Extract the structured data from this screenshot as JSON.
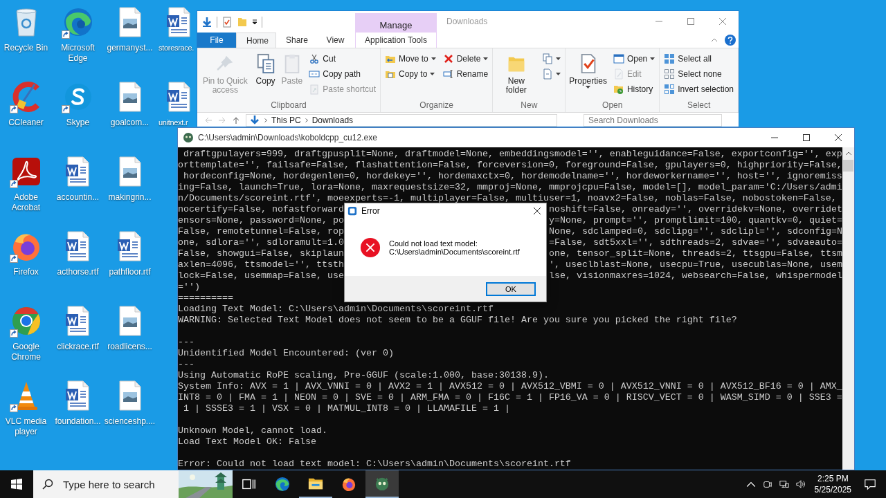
{
  "desktop": {
    "icons": [
      {
        "label": "Recycle Bin",
        "kind": "recycle-bin",
        "shortcut": false
      },
      {
        "label": "CCleaner",
        "kind": "ccleaner",
        "shortcut": true
      },
      {
        "label": "Adobe Acrobat",
        "kind": "acrobat",
        "shortcut": true
      },
      {
        "label": "Firefox",
        "kind": "firefox",
        "shortcut": true
      },
      {
        "label": "Google Chrome",
        "kind": "chrome",
        "shortcut": true
      },
      {
        "label": "VLC media player",
        "kind": "vlc",
        "shortcut": true
      },
      {
        "label": "Microsoft Edge",
        "kind": "edge",
        "shortcut": true
      },
      {
        "label": "Skype",
        "kind": "skype",
        "shortcut": true
      },
      {
        "label": "accountin...",
        "kind": "doc-file",
        "shortcut": false
      },
      {
        "label": "acthorse.rtf",
        "kind": "doc-file",
        "shortcut": false
      },
      {
        "label": "clickrace.rtf",
        "kind": "doc-file",
        "shortcut": false
      },
      {
        "label": "foundation...",
        "kind": "doc-file",
        "shortcut": false
      },
      {
        "label": "germanyst...",
        "kind": "image-file",
        "shortcut": false
      },
      {
        "label": "goalcom...",
        "kind": "image-file",
        "shortcut": false
      },
      {
        "label": "makingrin...",
        "kind": "image-file",
        "shortcut": false
      },
      {
        "label": "pathfloor.rtf",
        "kind": "doc-file",
        "shortcut": false
      },
      {
        "label": "roadlicens...",
        "kind": "image-file",
        "shortcut": false
      },
      {
        "label": "scienceshp....",
        "kind": "image-file",
        "shortcut": false
      },
      {
        "label": "storesrace.",
        "kind": "doc-file",
        "shortcut": false
      },
      {
        "label": "unitnext.r",
        "kind": "doc-file",
        "shortcut": false
      }
    ]
  },
  "explorer": {
    "context_tab": "Manage",
    "title": "Downloads",
    "tabs": [
      {
        "label": "File",
        "kind": "file",
        "selected": false
      },
      {
        "label": "Home",
        "kind": "normal",
        "selected": true
      },
      {
        "label": "Share",
        "kind": "normal",
        "selected": false
      },
      {
        "label": "View",
        "kind": "normal",
        "selected": false
      },
      {
        "label": "Application Tools",
        "kind": "context",
        "selected": false
      }
    ],
    "ribbon": [
      {
        "label": "Clipboard",
        "columns": [
          {
            "kind": "large",
            "items": [
              {
                "label": "Pin to Quick access",
                "disabled": true,
                "dropdown": false
              }
            ]
          },
          {
            "kind": "large",
            "items": [
              {
                "label": "Copy",
                "disabled": false,
                "dropdown": false
              }
            ]
          },
          {
            "kind": "large",
            "items": [
              {
                "label": "Paste",
                "disabled": true,
                "dropdown": false
              }
            ]
          },
          {
            "kind": "stack",
            "items": [
              {
                "label": "Cut",
                "disabled": false,
                "dropdown": false
              },
              {
                "label": "Copy path",
                "disabled": false,
                "dropdown": false
              },
              {
                "label": "Paste shortcut",
                "disabled": true,
                "dropdown": false
              }
            ]
          }
        ]
      },
      {
        "label": "Organize",
        "columns": [
          {
            "kind": "stack",
            "items": [
              {
                "label": "Move to",
                "disabled": false,
                "dropdown": true
              },
              {
                "label": "Copy to",
                "disabled": false,
                "dropdown": true
              }
            ]
          },
          {
            "kind": "stack",
            "items": [
              {
                "label": "Delete",
                "disabled": false,
                "dropdown": true
              },
              {
                "label": "Rename",
                "disabled": false,
                "dropdown": false
              }
            ]
          }
        ]
      },
      {
        "label": "New",
        "columns": [
          {
            "kind": "large",
            "items": [
              {
                "label": "New folder",
                "disabled": false,
                "dropdown": false
              }
            ]
          },
          {
            "kind": "stack",
            "items": [
              {
                "disabled": false,
                "dropdown": true
              },
              {
                "disabled": false,
                "dropdown": true
              }
            ]
          }
        ]
      },
      {
        "label": "Open",
        "columns": [
          {
            "kind": "large",
            "items": [
              {
                "label": "Properties",
                "disabled": false,
                "dropdown": true
              }
            ]
          },
          {
            "kind": "stack",
            "items": [
              {
                "label": "Open",
                "disabled": false,
                "dropdown": true
              },
              {
                "label": "Edit",
                "disabled": true,
                "dropdown": false
              },
              {
                "label": "History",
                "disabled": false,
                "dropdown": false
              }
            ]
          }
        ]
      },
      {
        "label": "Select",
        "columns": [
          {
            "kind": "stack",
            "items": [
              {
                "label": "Select all",
                "disabled": false,
                "dropdown": false
              },
              {
                "label": "Select none",
                "disabled": false,
                "dropdown": false
              },
              {
                "label": "Invert selection",
                "disabled": false,
                "dropdown": false
              }
            ]
          }
        ]
      }
    ],
    "breadcrumbs": [
      "This PC",
      "Downloads"
    ],
    "search_placeholder": "Search Downloads"
  },
  "console": {
    "title": "C:\\Users\\admin\\Downloads\\koboldcpp_cu12.exe",
    "lines": [
      {
        "kind": "text",
        "text": " draftgpulayers=999, draftgpusplit=None, draftmodel=None, embeddingsmodel='', enableguidance=False, exportconfig='', exp"
      },
      {
        "kind": "text",
        "text": "orttemplate='', failsafe=False, flashattention=False, forceversion=0, foreground=False, gpulayers=0, highpriority=False,"
      },
      {
        "kind": "text",
        "text": " hordeconfig=None, hordegenlen=0, hordekey='', hordemaxctx=0, hordemodelname='', hordeworkername='', host='', ignoremiss"
      },
      {
        "kind": "text",
        "text": "ing=False, launch=True, lora=None, maxrequestsize=32, mmproj=None, mmprojcpu=False, model=[], model_param='C:/Users/admi"
      },
      {
        "kind": "text",
        "text": "n/Documents/scoreint.rtf', moeexperts=-1, multiplayer=False, multiuser=1, noavx2=False, noblas=False, nobostoken=False,"
      },
      {
        "kind": "split",
        "left": "nocertify=False, nofastforward",
        "right": "noshift=False, onready='', overridekv=None, overridet"
      },
      {
        "kind": "split",
        "left": "ensors=None, password=None, po",
        "right": "y=None, prompt='', promptlimit=100, quantkv=0, quiet="
      },
      {
        "kind": "split",
        "left": "False, remotetunnel=False, rop",
        "right": "None, sdclamped=0, sdclipg='', sdclipl='', sdconfig=N"
      },
      {
        "kind": "split",
        "left": "one, sdlora='', sdloramult=1.0",
        "right": "=False, sdt5xxl='', sdthreads=2, sdvae='', sdvaeauto="
      },
      {
        "kind": "split",
        "left": "False, showgui=False, skiplaun",
        "right": "one, tensor_split=None, threads=2, ttsgpu=False, ttsm"
      },
      {
        "kind": "split",
        "left": "axlen=4096, ttsmodel='', ttsth",
        "right": "', useclblast=None, usecpu=True, usecublas=None, usem"
      },
      {
        "kind": "split",
        "left": "lock=False, usemmap=False, use",
        "right": "lse, visionmaxres=1024, websearch=False, whispermodel"
      },
      {
        "kind": "text",
        "text": "='')"
      },
      {
        "kind": "text",
        "text": "=========="
      },
      {
        "kind": "text",
        "text": "Loading Text Model: C:\\Users\\admin\\Documents\\scoreint.rtf"
      },
      {
        "kind": "text",
        "text": "WARNING: Selected Text Model does not seem to be a GGUF file! Are you sure you picked the right file?"
      },
      {
        "kind": "blank"
      },
      {
        "kind": "text",
        "text": "---"
      },
      {
        "kind": "text",
        "text": "Unidentified Model Encountered: (ver 0)"
      },
      {
        "kind": "text",
        "text": "---"
      },
      {
        "kind": "text",
        "text": "Using Automatic RoPE scaling, Pre-GGUF (scale:1.000, base:30138.9)."
      },
      {
        "kind": "text",
        "text": "System Info: AVX = 1 | AVX_VNNI = 0 | AVX2 = 1 | AVX512 = 0 | AVX512_VBMI = 0 | AVX512_VNNI = 0 | AVX512_BF16 = 0 | AMX_"
      },
      {
        "kind": "text",
        "text": "INT8 = 0 | FMA = 1 | NEON = 0 | SVE = 0 | ARM_FMA = 0 | F16C = 1 | FP16_VA = 0 | RISCV_VECT = 0 | WASM_SIMD = 0 | SSE3 ="
      },
      {
        "kind": "text",
        "text": " 1 | SSSE3 = 1 | VSX = 0 | MATMUL_INT8 = 0 | LLAMAFILE = 1 |"
      },
      {
        "kind": "blank"
      },
      {
        "kind": "text",
        "text": "Unknown Model, cannot load."
      },
      {
        "kind": "text",
        "text": "Load Text Model OK: False"
      },
      {
        "kind": "blank"
      },
      {
        "kind": "text",
        "text": "Error: Could not load text model: C:\\Users\\admin\\Documents\\scoreint.rtf"
      }
    ]
  },
  "dialog": {
    "title": "Error",
    "message": [
      "Could not load text model:",
      "C:\\Users\\admin\\Documents\\scoreint.rtf"
    ],
    "buttons": [
      {
        "label": "OK",
        "selected": true
      }
    ]
  },
  "taskbar": {
    "search_placeholder": "Type here to search",
    "apps": [
      {
        "kind": "task-view",
        "running": false,
        "selected": false
      },
      {
        "kind": "edge",
        "running": false,
        "selected": false
      },
      {
        "kind": "explorer",
        "running": true,
        "selected": false
      },
      {
        "kind": "firefox",
        "running": false,
        "selected": false
      },
      {
        "kind": "kobold",
        "running": true,
        "selected": true
      }
    ],
    "time": "2:25 PM",
    "date": "5/25/2025"
  }
}
